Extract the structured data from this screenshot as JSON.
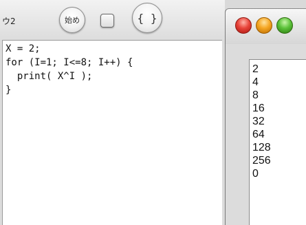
{
  "editor": {
    "window_title": "ウ2",
    "toolbar": {
      "run_label": "始め",
      "braces_label": "{ }"
    },
    "code_lines": [
      "X = 2;",
      "for (I=1; I<=8; I++) {",
      "  print( X^I );",
      "}"
    ]
  },
  "output": {
    "lines": [
      "2",
      "4",
      "8",
      "16",
      "32",
      "64",
      "128",
      "256",
      "0"
    ]
  },
  "colors": {
    "close": "#e8443a",
    "minimize": "#f5a623",
    "zoom": "#5cc23a"
  }
}
